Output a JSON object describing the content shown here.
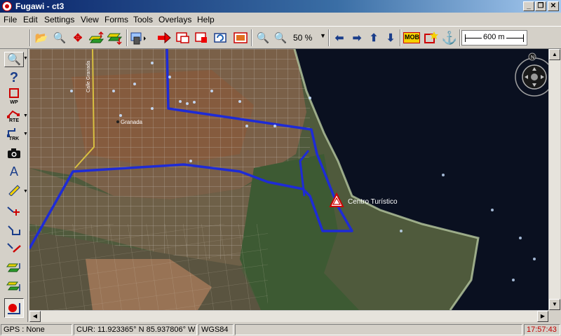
{
  "window": {
    "title": "Fugawi - ct3"
  },
  "menu": [
    "File",
    "Edit",
    "Settings",
    "View",
    "Forms",
    "Tools",
    "Overlays",
    "Help"
  ],
  "toolbar": {
    "zoom_level": "50 %",
    "scale_label": "600 m",
    "mob_label": "MOB"
  },
  "left_tools": {
    "wp_label": "WP",
    "rte_label": "RTE",
    "trk_label": "TRK"
  },
  "map": {
    "town_label": "Granada",
    "street_label": "Calle Granada",
    "waypoint_label": "Centro Turístico",
    "compass_north": "N"
  },
  "status": {
    "gps": "GPS : None",
    "cursor": "CUR: 11.923365° N 85.937806° W",
    "datum": "WGS84",
    "time": "17:57:43"
  },
  "colors": {
    "route": "#1e2bd6",
    "title_bar": "#0a246a",
    "time_text": "#c00000"
  }
}
